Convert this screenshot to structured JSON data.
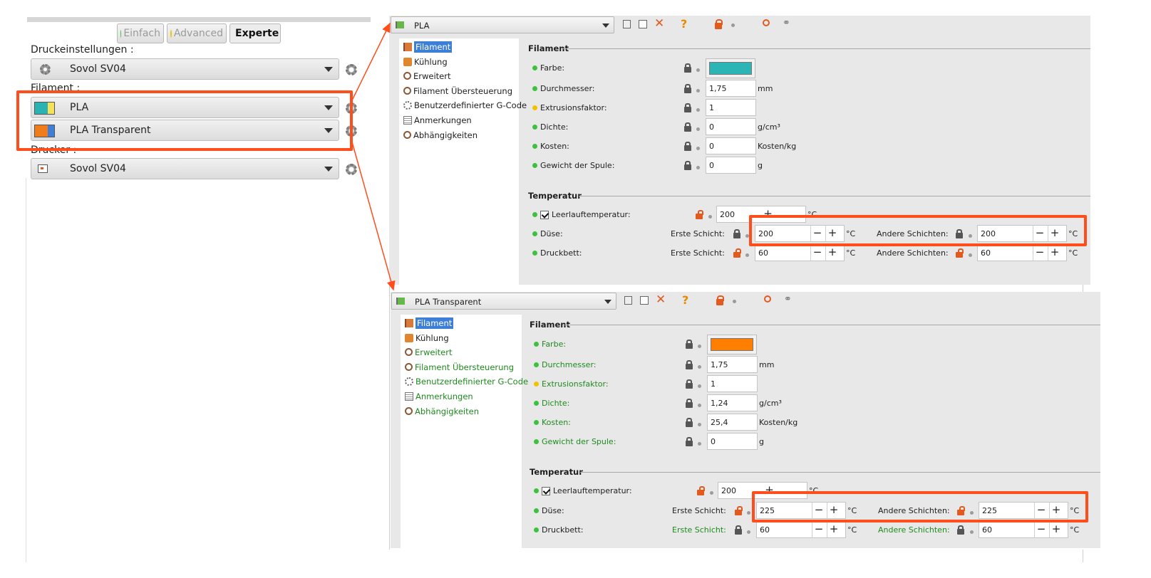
{
  "left": {
    "modes": [
      {
        "label": "Einfach",
        "color": "#44c23a"
      },
      {
        "label": "Advanced",
        "color": "#f2c200"
      },
      {
        "label": "Experte",
        "color": "#e02a1e"
      }
    ],
    "print_settings_label": "Druckeinstellungen :",
    "print_settings_value": "Sovol SV04",
    "filament_label": "Filament :",
    "filament_1": {
      "value": "PLA",
      "swatch": [
        "#2bb2b2",
        "#f5e15a"
      ]
    },
    "filament_2": {
      "value": "PLA Transparent",
      "swatch": [
        "#f07d1a",
        "#3f7fd6"
      ]
    },
    "printer_label": "Drucker :",
    "printer_value": "Sovol SV04"
  },
  "panels": [
    {
      "preset": "PLA",
      "tree": [
        "Filament",
        "Kühlung",
        "Erweitert",
        "Filament Übersteuerung",
        "Benutzerdefinierter G-Code",
        "Anmerkungen",
        "Abhängigkeiten"
      ],
      "filament_group": "Filament",
      "color_label": "Farbe:",
      "color_value": "#2bb5b5",
      "diameter_label": "Durchmesser:",
      "diameter": "1,75",
      "diameter_unit": "mm",
      "extrusion_label": "Extrusionsfaktor:",
      "extrusion": "1",
      "density_label": "Dichte:",
      "density": "0",
      "density_unit": "g/cm³",
      "cost_label": "Kosten:",
      "cost": "0",
      "cost_unit": "Kosten/kg",
      "spool_label": "Gewicht der Spule:",
      "spool": "0",
      "spool_unit": "g",
      "temp_group": "Temperatur",
      "idle_label": "Leerlauftemperatur:",
      "idle": "200",
      "idle_unit": "°C",
      "nozzle_label": "Düse:",
      "first_layer": "Erste Schicht:",
      "other_layers": "Andere Schichten:",
      "nozzle_first": "200",
      "nozzle_other": "200",
      "bed_label": "Druckbett:",
      "bed_first": "60",
      "bed_other": "60",
      "deg": "°C"
    },
    {
      "preset": "PLA Transparent",
      "tree": [
        "Filament",
        "Kühlung",
        "Erweitert",
        "Filament Übersteuerung",
        "Benutzerdefinierter G-Code",
        "Anmerkungen",
        "Abhängigkeiten"
      ],
      "filament_group": "Filament",
      "color_label": "Farbe:",
      "color_value": "#ff8000",
      "diameter_label": "Durchmesser:",
      "diameter": "1,75",
      "diameter_unit": "mm",
      "extrusion_label": "Extrusionsfaktor:",
      "extrusion": "1",
      "density_label": "Dichte:",
      "density": "1,24",
      "density_unit": "g/cm³",
      "cost_label": "Kosten:",
      "cost": "25,4",
      "cost_unit": "Kosten/kg",
      "spool_label": "Gewicht der Spule:",
      "spool": "0",
      "spool_unit": "g",
      "temp_group": "Temperatur",
      "idle_label": "Leerlauftemperatur:",
      "idle": "200",
      "idle_unit": "°C",
      "nozzle_label": "Düse:",
      "first_layer": "Erste Schicht:",
      "other_layers": "Andere Schichten:",
      "nozzle_first": "225",
      "nozzle_other": "225",
      "bed_label": "Druckbett:",
      "bed_first": "60",
      "bed_other": "60",
      "deg": "°C"
    }
  ],
  "colors": {
    "highlight": "#ff4e1c",
    "selection": "#3d7fd6",
    "modified_text": "#1f8a1f"
  }
}
